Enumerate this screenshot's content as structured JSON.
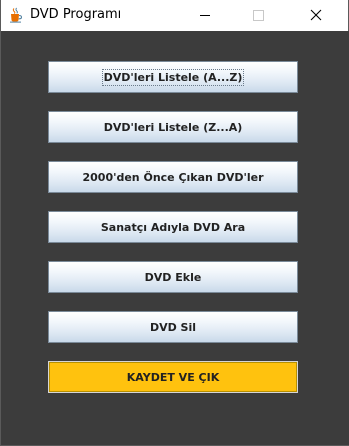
{
  "window": {
    "title": "DVD Programı",
    "icon": "java-cup-icon"
  },
  "controls": {
    "minimize_icon": "minimize-icon",
    "maximize_icon": "maximize-icon",
    "close_icon": "close-icon"
  },
  "buttons": [
    {
      "label": "DVD'leri Listele (A...Z)"
    },
    {
      "label": "DVD'leri Listele (Z...A)"
    },
    {
      "label": "2000'den Önce Çıkan DVD'ler"
    },
    {
      "label": "Sanatçı Adıyla DVD Ara"
    },
    {
      "label": "DVD Ekle"
    },
    {
      "label": "DVD Sil"
    },
    {
      "label": "KAYDET VE ÇIK"
    }
  ],
  "colors": {
    "panel_background": "#3c3c3c",
    "save_button": "#ffc20e"
  }
}
